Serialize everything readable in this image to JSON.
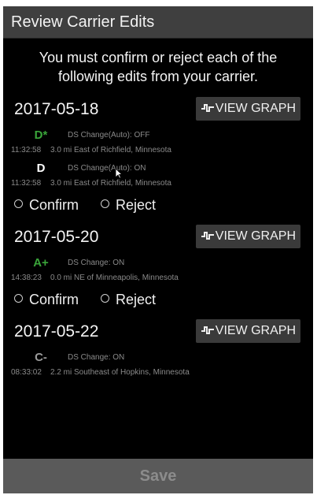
{
  "title": "Review Carrier Edits",
  "instructions": "You must confirm or reject each of the following edits from your carrier.",
  "view_graph_label": "VIEW GRAPH",
  "confirm_label": "Confirm",
  "reject_label": "Reject",
  "save_label": "Save",
  "colors": {
    "green": "#3aa53a",
    "white": "#ffffff",
    "gray_text": "#8a8a8a"
  },
  "groups": [
    {
      "date": "2017-05-18",
      "events": [
        {
          "grade": "D*",
          "grade_color": "#3aa53a",
          "type": "DS Change(Auto): OFF",
          "time": "11:32:58",
          "location": "3.0 mi East of Richfield, Minnesota"
        },
        {
          "grade": "D",
          "grade_color": "#ffffff",
          "type": "DS Change(Auto): ON",
          "time": "11:32:58",
          "location": "3.0 mi East of Richfield, Minnesota"
        }
      ]
    },
    {
      "date": "2017-05-20",
      "events": [
        {
          "grade": "A+",
          "grade_color": "#3aa53a",
          "type": "DS Change: ON",
          "time": "14:38:23",
          "location": "0.0 mi NE of Minneapolis, Minnesota"
        }
      ]
    },
    {
      "date": "2017-05-22",
      "events": [
        {
          "grade": "C-",
          "grade_color": "#9a9a9a",
          "type": "DS Change: ON",
          "time": "08:33:02",
          "location": "2.2 mi Southeast of Hopkins, Minnesota"
        }
      ]
    }
  ]
}
